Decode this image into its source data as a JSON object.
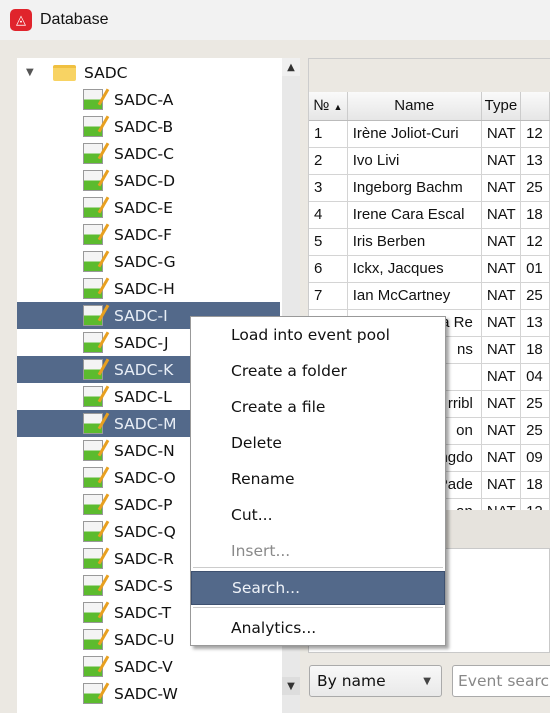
{
  "window": {
    "title": "Database",
    "icon": "app-logo-icon"
  },
  "tree": {
    "root": "SADC",
    "items": [
      "SADC-A",
      "SADC-B",
      "SADC-C",
      "SADC-D",
      "SADC-E",
      "SADC-F",
      "SADC-G",
      "SADC-H",
      "SADC-I",
      "SADC-J",
      "SADC-K",
      "SADC-L",
      "SADC-M",
      "SADC-N",
      "SADC-O",
      "SADC-P",
      "SADC-Q",
      "SADC-R",
      "SADC-S",
      "SADC-T",
      "SADC-U",
      "SADC-V",
      "SADC-W"
    ],
    "selected": [
      "SADC-I",
      "SADC-K",
      "SADC-M"
    ]
  },
  "table": {
    "headers": [
      "№",
      "Name",
      "Type",
      ""
    ],
    "sort": "№ ascending",
    "rows": [
      [
        "1",
        "Irène Joliot-Curi",
        "NAT",
        "12"
      ],
      [
        "2",
        "Ivo Livi",
        "NAT",
        "13"
      ],
      [
        "3",
        "Ingeborg Bachm",
        "NAT",
        "25"
      ],
      [
        "4",
        "Irene Cara Escal",
        "NAT",
        "18"
      ],
      [
        "5",
        "Iris Berben",
        "NAT",
        "12"
      ],
      [
        "6",
        "Ickx, Jacques",
        "NAT",
        "01"
      ],
      [
        "7",
        "Ian McCartney",
        "NAT",
        "25"
      ],
      [
        "",
        "a Re",
        "NAT",
        "13"
      ],
      [
        "",
        "ns",
        "NAT",
        "18"
      ],
      [
        "",
        "",
        "NAT",
        "04"
      ],
      [
        "",
        "rribl",
        "NAT",
        "25"
      ],
      [
        "",
        "on",
        "NAT",
        "25"
      ],
      [
        "",
        "ngdo",
        "NAT",
        "09"
      ],
      [
        "",
        "Pade",
        "NAT",
        "18"
      ],
      [
        "",
        "an",
        "NAT",
        "12"
      ]
    ]
  },
  "context_menu": {
    "items": [
      {
        "label": "Load into event pool"
      },
      {
        "label": "Create a folder"
      },
      {
        "label": "Create a file"
      },
      {
        "label": "Delete"
      },
      {
        "label": "Rename"
      },
      {
        "label": "Cut..."
      },
      {
        "label": "Insert...",
        "disabled": true
      },
      {
        "label": "Search...",
        "highlighted": true
      },
      {
        "label": "Analytics..."
      }
    ]
  },
  "bottom": {
    "sort_combo": "By name",
    "search_placeholder": "Event search"
  },
  "colors": {
    "selection": "#53698a",
    "logo": "#e0242c"
  }
}
